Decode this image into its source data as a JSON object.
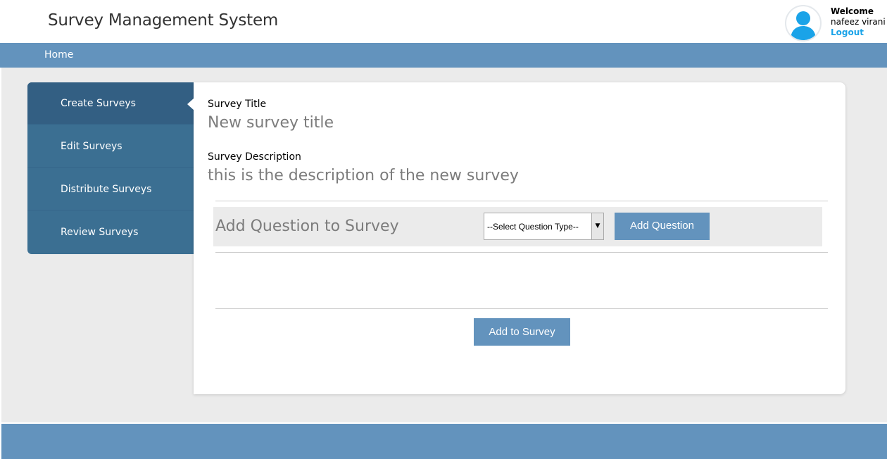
{
  "header": {
    "title": "Survey Management System",
    "welcome": "Welcome",
    "user_name": "nafeez virani",
    "logout": "Logout"
  },
  "nav": {
    "home": "Home"
  },
  "sidebar": {
    "items": [
      {
        "label": "Create Surveys",
        "active": true
      },
      {
        "label": "Edit Surveys"
      },
      {
        "label": "Distribute Surveys"
      },
      {
        "label": "Review Surveys"
      }
    ]
  },
  "form": {
    "title_label": "Survey Title",
    "title_value": "New survey title",
    "description_label": "Survey Description",
    "description_value": "this is the description of the new survey",
    "add_question_heading": "Add Question to Survey",
    "question_type_selected": "--Select Question Type--",
    "add_question_button": "Add Question",
    "add_to_survey_button": "Add to Survey"
  },
  "colors": {
    "brand_blue": "#6393bd",
    "sidebar_bg": "#3b6f92",
    "logout_link": "#1aa3e8"
  },
  "icons": {
    "avatar": "user-avatar-icon",
    "dropdown": "triangle-down-icon"
  }
}
